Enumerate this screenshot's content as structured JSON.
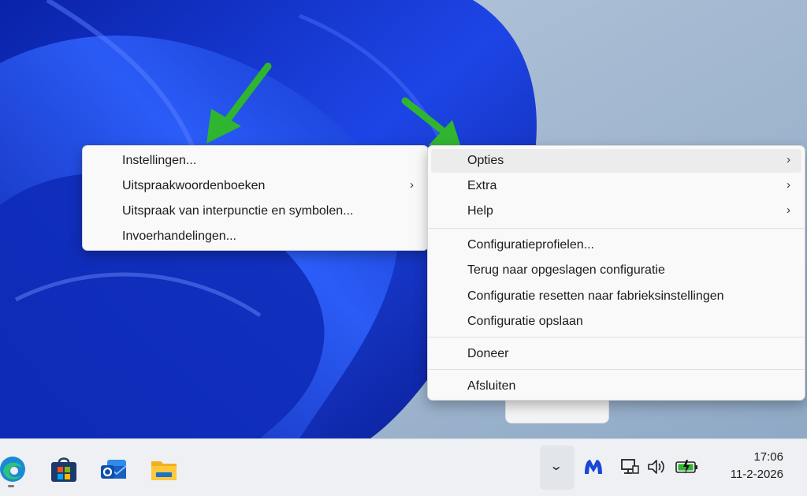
{
  "context_menu_left": {
    "items": [
      {
        "label": "Instellingen...",
        "submenu": false
      },
      {
        "label": "Uitspraakwoordenboeken",
        "submenu": true
      },
      {
        "label": "Uitspraak van interpunctie en symbolen...",
        "submenu": false
      },
      {
        "label": "Invoerhandelingen...",
        "submenu": false
      }
    ]
  },
  "context_menu_right": {
    "items": [
      {
        "label": "Opties",
        "submenu": true,
        "active": true
      },
      {
        "label": "Extra",
        "submenu": true
      },
      {
        "label": "Help",
        "submenu": true
      },
      {
        "label": "Configuratieprofielen...",
        "submenu": false
      },
      {
        "label": "Terug naar opgeslagen configuratie",
        "submenu": false
      },
      {
        "label": "Configuratie resetten naar fabrieksinstellingen",
        "submenu": false
      },
      {
        "label": "Configuratie opslaan",
        "submenu": false
      },
      {
        "label": "Doneer",
        "submenu": false
      },
      {
        "label": "Afsluiten",
        "submenu": false
      }
    ]
  },
  "chevron": "›",
  "taskbar": {
    "pinned": [
      {
        "name": "edge-icon"
      },
      {
        "name": "microsoft-store-icon"
      },
      {
        "name": "outlook-icon"
      },
      {
        "name": "file-explorer-icon"
      }
    ],
    "tray_chevron": "⌄",
    "tray_icons": [
      "malwarebytes-icon",
      "network-icon",
      "volume-icon",
      "battery-icon"
    ],
    "clock_time": "17:06",
    "clock_date": "11-2-2026"
  },
  "colors": {
    "wallpaper_blue": "#1030c8",
    "arrow_green": "#2fb52f",
    "menu_bg": "#f9f9f9"
  }
}
